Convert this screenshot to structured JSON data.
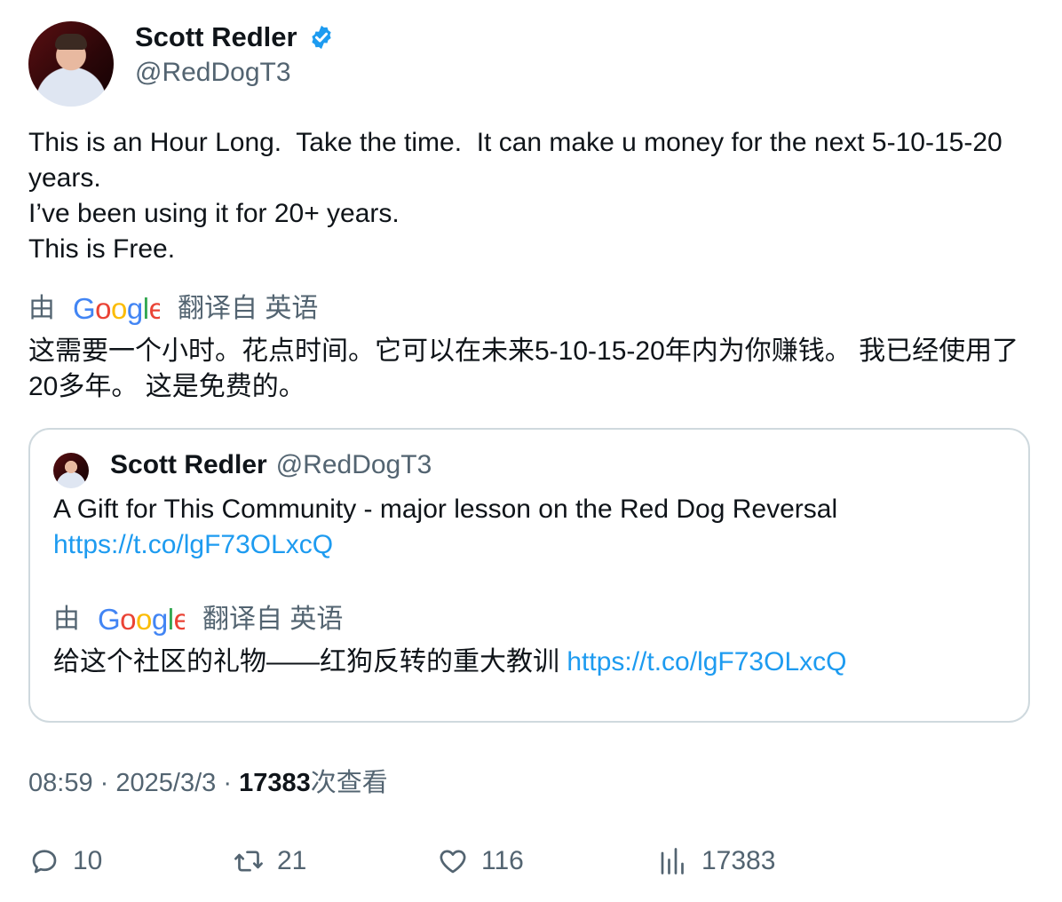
{
  "author": {
    "name": "Scott Redler",
    "handle": "@RedDogT3"
  },
  "tweet": {
    "lines": [
      "This is an Hour Long.  Take the time.  It can make u money for the next 5-10-15-20 years.",
      "I’ve been using it for 20+ years.",
      "This is Free."
    ],
    "translate_by": "由",
    "translate_from": "翻译自 英语",
    "translation": "这需要一个小时。花点时间。它可以在未来5-10-15-20年内为你赚钱。 我已经使用了20多年。 这是免费的。"
  },
  "quote": {
    "name": "Scott Redler",
    "handle": "@RedDogT3",
    "text": "A Gift for This Community - major lesson on the Red Dog Reversal",
    "link": "https://t.co/lgF73OLxcQ",
    "translate_by": "由",
    "translate_from": "翻译自 英语",
    "translation": "给这个社区的礼物——红狗反转的重大教训",
    "translation_link": "https://t.co/lgF73OLxcQ"
  },
  "meta": {
    "time": "08:59",
    "date": "2025/3/3",
    "views": "17383",
    "views_suffix": "次查看",
    "sep": "·"
  },
  "actions": {
    "replies": "10",
    "retweets": "21",
    "likes": "116",
    "views": "17383"
  },
  "icons": [
    "verified-badge-icon",
    "google-logo-icon",
    "reply-icon",
    "retweet-icon",
    "like-icon",
    "views-icon"
  ],
  "colors": {
    "verified": "#1d9bf0",
    "link": "#1d9bf0",
    "secondary_text": "#536471"
  }
}
